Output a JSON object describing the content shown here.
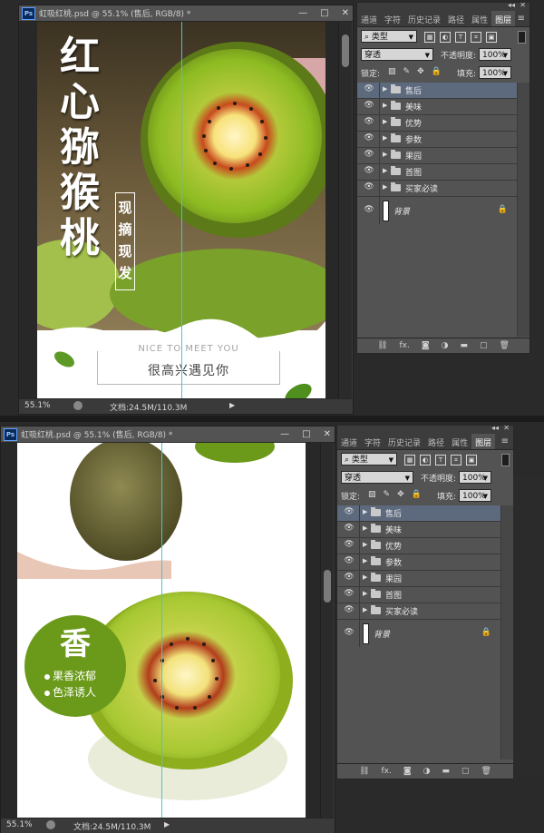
{
  "window": {
    "title": "虹吸红桃.psd @ 55.1% (售后, RGB/8) *",
    "zoom": "55.1%",
    "doc_size": "文档:24.5M/110.3M",
    "minimize": "—",
    "maximize": "□",
    "close": "✕"
  },
  "panel": {
    "tabs": [
      "通道",
      "字符",
      "历史记录",
      "路径",
      "属性",
      "图层"
    ],
    "active_tab": "图层",
    "filter_type": "类型",
    "blend_mode": "穿透",
    "opacity_label": "不透明度:",
    "opacity_value": "100%",
    "lock_label": "锁定:",
    "fill_label": "填充:",
    "fill_value": "100%",
    "layers": [
      "售后",
      "美味",
      "优势",
      "参数",
      "果园",
      "首图",
      "买家必读"
    ],
    "selected_layer": "售后",
    "background_layer": "背景",
    "bottom_icons": [
      "link-icon",
      "fx-icon",
      "mask-icon",
      "adjustment-icon",
      "group-icon",
      "new-layer-icon",
      "delete-icon"
    ]
  },
  "artwork1": {
    "title_chars": [
      "红",
      "心",
      "猕",
      "猴",
      "桃"
    ],
    "tag_chars": [
      "现",
      "摘",
      "现",
      "发"
    ],
    "nice_en": "NICE TO MEET YOU",
    "nice_cn": "很高兴遇见你"
  },
  "artwork2": {
    "badge_big": "香",
    "badge_line1": "果香浓郁",
    "badge_line2": "色泽诱人"
  },
  "colors": {
    "kiwi_green": "#8fbf2a",
    "badge_green": "#6b9a1a",
    "guide": "#49c3d6",
    "selected_layer": "#5d6a7e"
  }
}
